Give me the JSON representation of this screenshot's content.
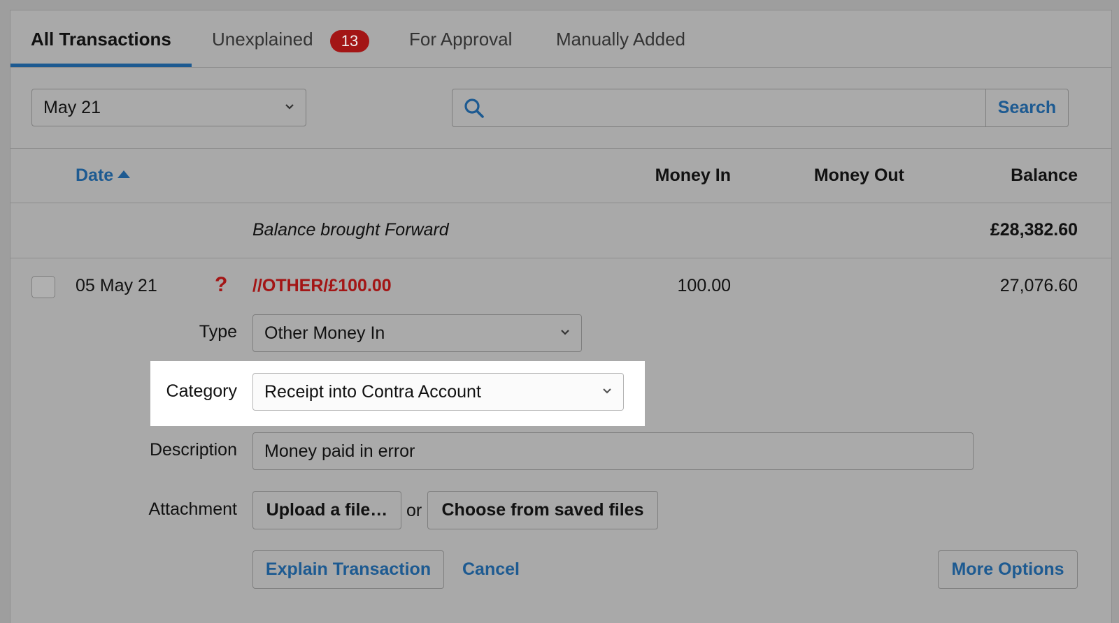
{
  "tabs": [
    {
      "label": "All Transactions"
    },
    {
      "label": "Unexplained",
      "badge": "13"
    },
    {
      "label": "For Approval"
    },
    {
      "label": "Manually Added"
    }
  ],
  "filter": {
    "period": "May 21",
    "search_placeholder": "",
    "search_button": "Search"
  },
  "table": {
    "headers": {
      "date": "Date",
      "money_in": "Money In",
      "money_out": "Money Out",
      "balance": "Balance"
    },
    "brought_forward": {
      "label": "Balance brought Forward",
      "amount": "£28,382.60"
    },
    "transaction": {
      "date": "05 May 21",
      "status_mark": "?",
      "description": "//OTHER/£100.00",
      "money_in": "100.00",
      "balance": "27,076.60"
    }
  },
  "form": {
    "type_label": "Type",
    "type_value": "Other Money In",
    "category_label": "Category",
    "category_value": "Receipt into Contra Account",
    "description_label": "Description",
    "description_value": "Money paid in error",
    "attachment_label": "Attachment",
    "upload_button": "Upload a file…",
    "or_text": "or",
    "saved_files_button": "Choose from saved files",
    "explain_button": "Explain Transaction",
    "cancel_link": "Cancel",
    "more_options_button": "More Options"
  },
  "colors": {
    "accent": "#1d5a91",
    "alert": "#a31515",
    "overlay_bg": "#a9a9a9",
    "highlight": "#ffffff"
  }
}
